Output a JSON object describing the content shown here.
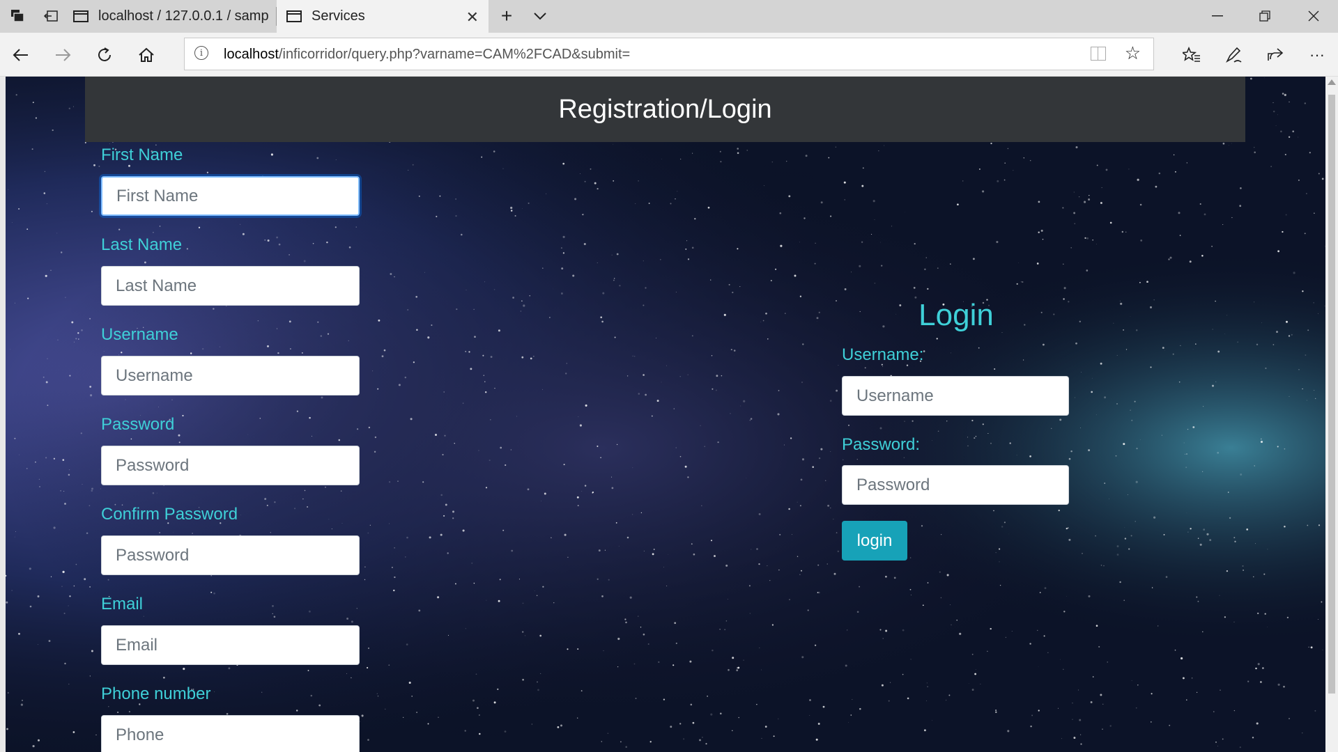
{
  "browser": {
    "tabs": [
      {
        "label": "localhost / 127.0.0.1 / samp"
      },
      {
        "label": "Services"
      }
    ],
    "url_host": "localhost",
    "url_path": "/inficorridor/query.php?varname=CAM%2FCAD&submit="
  },
  "page": {
    "header_title": "Registration/Login",
    "registration": {
      "fields": [
        {
          "label": "First Name",
          "placeholder": "First Name"
        },
        {
          "label": "Last Name",
          "placeholder": "Last Name"
        },
        {
          "label": "Username",
          "placeholder": "Username"
        },
        {
          "label": "Password",
          "placeholder": "Password"
        },
        {
          "label": "Confirm Password",
          "placeholder": "Password"
        },
        {
          "label": "Email",
          "placeholder": "Email"
        },
        {
          "label": "Phone number",
          "placeholder": "Phone"
        }
      ]
    },
    "login": {
      "title": "Login",
      "username_label": "Username:",
      "username_placeholder": "Username",
      "password_label": "Password:",
      "password_placeholder": "Password",
      "button_label": "login"
    }
  },
  "colors": {
    "accent_text": "#3fd0d8",
    "header_bg": "#333639",
    "button_bg": "#17a2b8"
  }
}
